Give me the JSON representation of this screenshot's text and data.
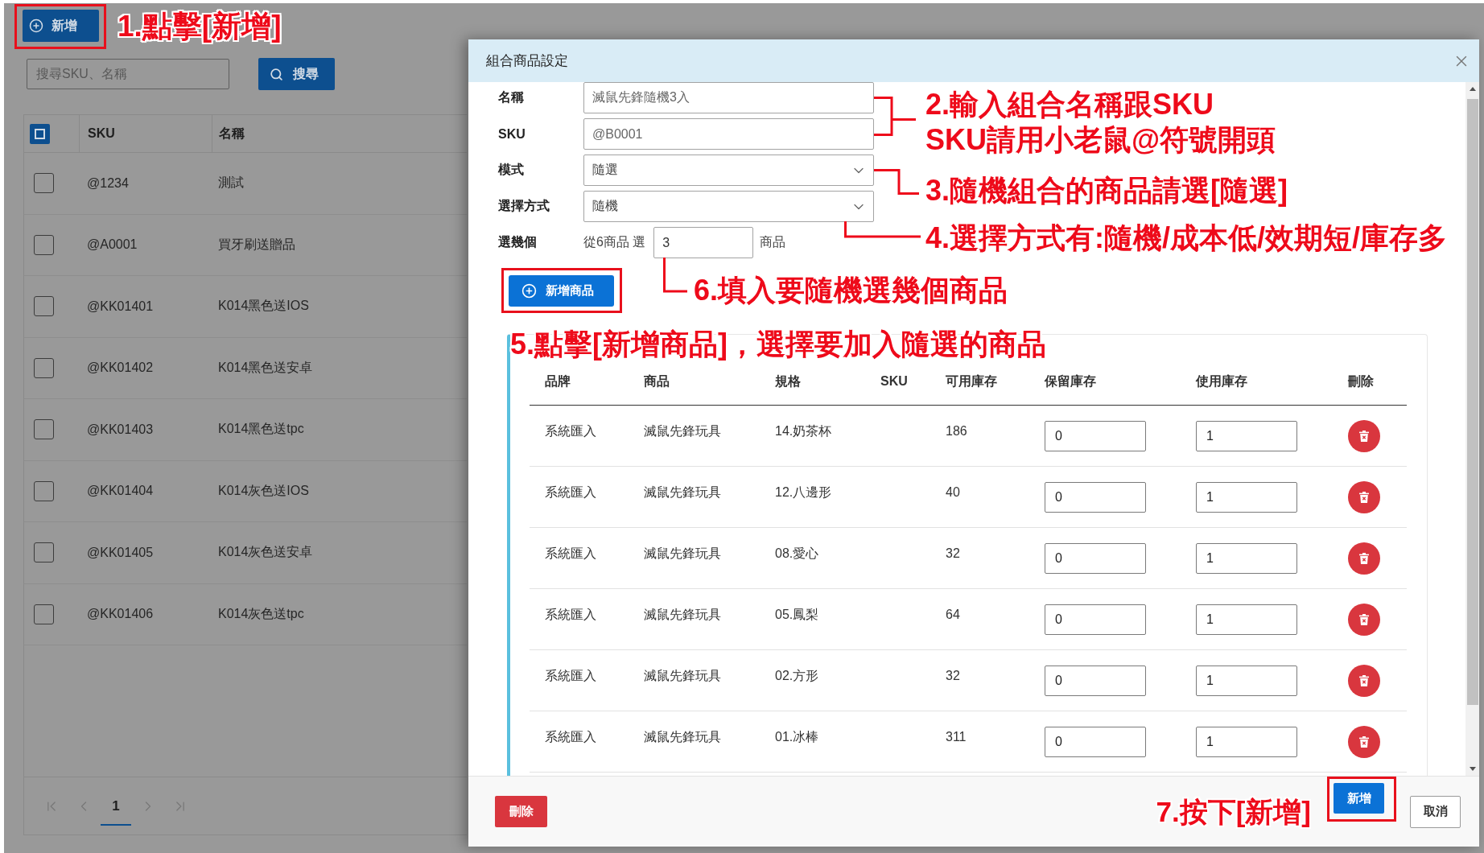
{
  "page": {
    "add_button": {
      "label": "新增",
      "highlighted": true
    },
    "annotation": "1.點擊[新增]",
    "search": {
      "placeholder": "搜尋SKU、名稱",
      "button": "搜尋"
    },
    "table": {
      "select_all": {
        "focused": true
      },
      "columns": [
        "SKU",
        "名稱"
      ],
      "rows": [
        {
          "checked": false,
          "sku": "@1234",
          "name": "測試"
        },
        {
          "checked": false,
          "sku": "@A0001",
          "name": "買牙刷送贈品"
        },
        {
          "checked": false,
          "sku": "@KK01401",
          "name": "K014黑色送IOS"
        },
        {
          "checked": false,
          "sku": "@KK01402",
          "name": "K014黑色送安卓"
        },
        {
          "checked": false,
          "sku": "@KK01403",
          "name": "K014黑色送tpc"
        },
        {
          "checked": false,
          "sku": "@KK01404",
          "name": "K014灰色送IOS"
        },
        {
          "checked": false,
          "sku": "@KK01405",
          "name": "K014灰色送安卓"
        },
        {
          "checked": false,
          "sku": "@KK01406",
          "name": "K014灰色送tpc"
        }
      ]
    },
    "pagination": {
      "pages": [
        {
          "label": "1",
          "selected": true
        }
      ]
    }
  },
  "dialog": {
    "title": "組合商品設定",
    "fields": [
      {
        "kind": "text",
        "label": "名稱",
        "value": "滅鼠先鋒隨機3入"
      },
      {
        "kind": "text",
        "label": "SKU",
        "value": "@B0001"
      },
      {
        "kind": "select",
        "label": "模式",
        "value": "隨選"
      },
      {
        "kind": "select",
        "label": "選擇方式",
        "value": "隨機"
      },
      {
        "kind": "count",
        "label": "選幾個",
        "prefix": "從6商品 選",
        "value": "3",
        "suffix": "商品"
      }
    ],
    "add_product_button": {
      "label": "新增商品",
      "highlighted": true
    },
    "annotations": [
      {
        "lines": [
          "2.輸入組合名稱跟SKU",
          "SKU請用小老鼠@符號開頭"
        ]
      },
      {
        "lines": [
          "3.隨機組合的商品請選[隨選]"
        ]
      },
      {
        "lines": [
          "4.選擇方式有:隨機/成本低/效期短/庫存多"
        ]
      },
      {
        "lines": [
          "6.填入要隨機選幾個商品"
        ]
      },
      {
        "lines": [
          "5.點擊[新增商品]，選擇要加入隨選的商品"
        ]
      }
    ],
    "products": {
      "columns": [
        "品牌",
        "商品",
        "規格",
        "SKU",
        "可用庫存",
        "保留庫存",
        "使用庫存",
        "刪除"
      ],
      "rows": [
        {
          "brand": "系統匯入",
          "product": "滅鼠先鋒玩具",
          "spec": "14.奶茶杯",
          "available": "186",
          "reserved": "0",
          "used": "1"
        },
        {
          "brand": "系統匯入",
          "product": "滅鼠先鋒玩具",
          "spec": "12.八邊形",
          "available": "40",
          "reserved": "0",
          "used": "1"
        },
        {
          "brand": "系統匯入",
          "product": "滅鼠先鋒玩具",
          "spec": "08.愛心",
          "available": "32",
          "reserved": "0",
          "used": "1"
        },
        {
          "brand": "系統匯入",
          "product": "滅鼠先鋒玩具",
          "spec": "05.鳳梨",
          "available": "64",
          "reserved": "0",
          "used": "1"
        },
        {
          "brand": "系統匯入",
          "product": "滅鼠先鋒玩具",
          "spec": "02.方形",
          "available": "32",
          "reserved": "0",
          "used": "1"
        },
        {
          "brand": "系統匯入",
          "product": "滅鼠先鋒玩具",
          "spec": "01.冰棒",
          "available": "311",
          "reserved": "0",
          "used": "1"
        }
      ]
    },
    "footer": {
      "delete_button": "刪除",
      "annotation": "7.按下[新增]",
      "submit_button": {
        "label": "新增",
        "highlighted": true
      },
      "cancel_button": "取消"
    }
  }
}
